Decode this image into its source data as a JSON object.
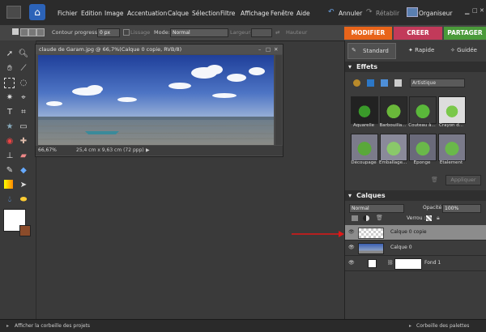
{
  "menubar": {
    "items": [
      "Fichier",
      "Edition",
      "Image",
      "Accentuation",
      "Calque",
      "Sélection",
      "Filtre",
      "Affichage",
      "Fenêtre",
      "Aide"
    ],
    "undo_label": "Annuler",
    "redo_label": "Rétablir",
    "organizer_label": "Organiseur"
  },
  "options": {
    "contour_label": "Contour progressif:",
    "contour_value": "0 px",
    "lissage_label": "Lissage",
    "mode_label": "Mode:",
    "mode_value": "Normal",
    "largeur_label": "Largeur:",
    "hauteur_label": "Hauteur"
  },
  "tabs": [
    {
      "label": "MODIFIER",
      "color": "#e8641a"
    },
    {
      "label": "CREER",
      "color": "#c23a5a"
    },
    {
      "label": "PARTAGER",
      "color": "#4a9a3a"
    }
  ],
  "mode_buttons": [
    "Standard",
    "Rapide",
    "Guidée"
  ],
  "document": {
    "title": "claude de Garam.jpg @ 66,7%(Calque 0 copie, RVB/8)",
    "zoom": "66,67%",
    "dimensions": "25,4 cm x 9,63 cm (72 ppp)"
  },
  "effects": {
    "title": "Effets",
    "category": "Artistique",
    "apply_label": "Appliquer",
    "items": [
      "Aquarelle",
      "Barbouilla...",
      "Couteau à...",
      "Crayon d...",
      "Découpage",
      "Emballage...",
      "Eponge",
      "Etalement"
    ]
  },
  "layers": {
    "title": "Calques",
    "blend_mode": "Normal",
    "opacity_label": "Opacité:",
    "opacity_value": "100%",
    "lock_label": "Verrou :",
    "rows": [
      {
        "name": "Calque 0 copie"
      },
      {
        "name": "Calque 0"
      },
      {
        "name": "Fond 1"
      }
    ]
  },
  "bottombar": {
    "left_label": "Afficher la corbeille des projets",
    "right_label": "Corbeille des palettes"
  }
}
